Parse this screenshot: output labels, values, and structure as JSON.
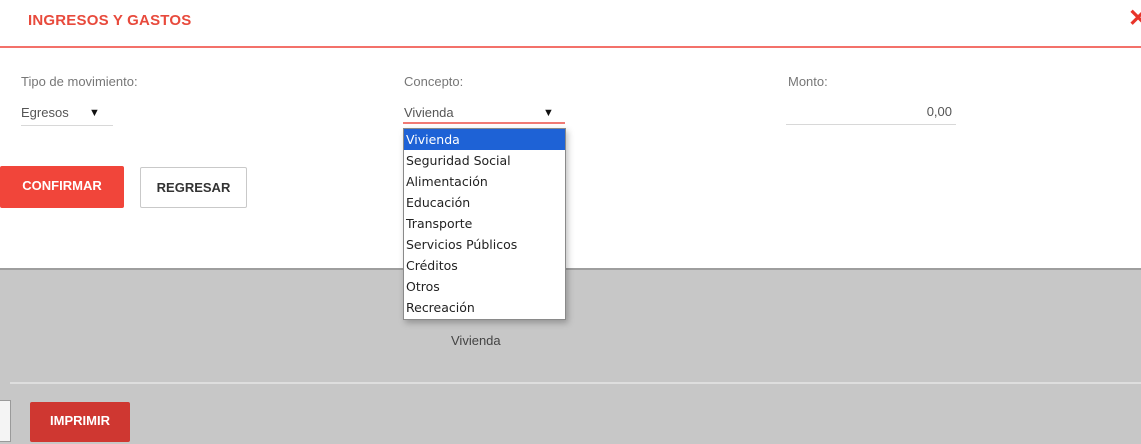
{
  "header": {
    "title": "INGRESOS Y GASTOS",
    "close_label": "✕"
  },
  "form": {
    "movement_type": {
      "label": "Tipo de movimiento:",
      "value": "Egresos",
      "arrow": "▼"
    },
    "concept": {
      "label": "Concepto:",
      "value": "Vivienda",
      "arrow": "▼",
      "options": [
        "Vivienda",
        "Seguridad Social",
        "Alimentación",
        "Educación",
        "Transporte",
        "Servicios Públicos",
        "Créditos",
        "Otros",
        "Recreación"
      ],
      "selected_index": 0
    },
    "amount": {
      "label": "Monto:",
      "value": "0,00"
    }
  },
  "buttons": {
    "confirm": "CONFIRMAR",
    "back": "REGRESAR",
    "print": "IMPRIMIR"
  },
  "summary": {
    "concept": "Vivienda"
  },
  "colors": {
    "accent": "#f1453a",
    "print": "#cf3731",
    "highlight": "#1e62d6",
    "band": "#c7c7c7"
  }
}
